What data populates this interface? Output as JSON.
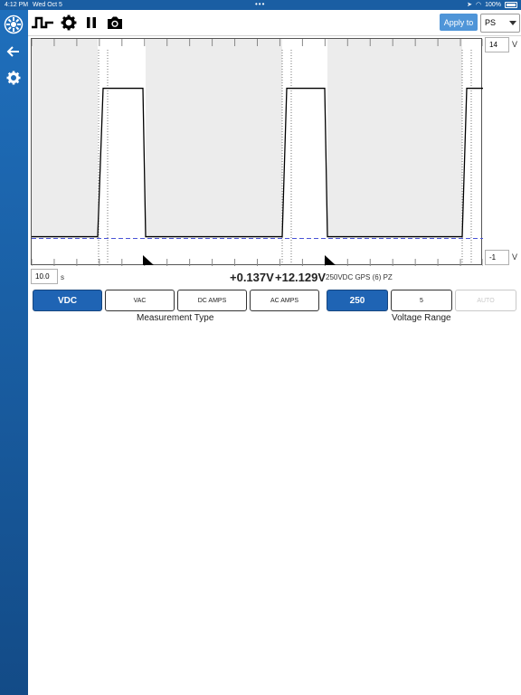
{
  "status_bar": {
    "time": "4:12 PM",
    "date": "Wed Oct 5",
    "battery": "100%",
    "indicators": [
      "location-icon",
      "wifi-icon",
      "battery-icon"
    ]
  },
  "sidebar": {
    "icons": [
      "app-logo-icon",
      "back-arrow-icon",
      "gear-icon"
    ]
  },
  "toolbar": {
    "icons": [
      "waveform-icon",
      "settings-gear-icon",
      "pause-icon",
      "camera-icon"
    ],
    "apply_label": "Apply to",
    "probe_select": "PS"
  },
  "scope": {
    "y_max": "14",
    "y_min": "-1",
    "y_unit": "V",
    "time_div": "10.0",
    "time_unit": "s"
  },
  "chart_data": {
    "type": "line",
    "ylim": [
      -1,
      14
    ],
    "y_max_label": "14",
    "y_min_label": "-1",
    "series": [
      {
        "x": [
          0,
          73,
          79,
          123,
          126,
          277,
          282,
          324,
          327,
          476,
          481,
          499
        ],
        "values": [
          0.13,
          0.13,
          12.13,
          12.13,
          0.13,
          0.13,
          12.13,
          12.13,
          0.13,
          0.13,
          12.13,
          12.13
        ]
      }
    ],
    "trigger_level": 0.13
  },
  "readout": {
    "min": "+0.137V",
    "max": "+12.129V",
    "meta": "250VDC GPS (6) PZ"
  },
  "measurement_type": {
    "label": "Measurement Type",
    "options": [
      "VDC",
      "VAC",
      "DC AMPS",
      "AC AMPS"
    ],
    "selected": "VDC"
  },
  "voltage_range": {
    "label": "Voltage Range",
    "options": [
      "250",
      "5",
      "AUTO"
    ],
    "selected": "250"
  },
  "colors": {
    "accent": "#1f64b4",
    "sidebar": "#1a5ea3",
    "trace": "#000000",
    "trigger": "#4a54d6",
    "shade": "#ececec"
  }
}
